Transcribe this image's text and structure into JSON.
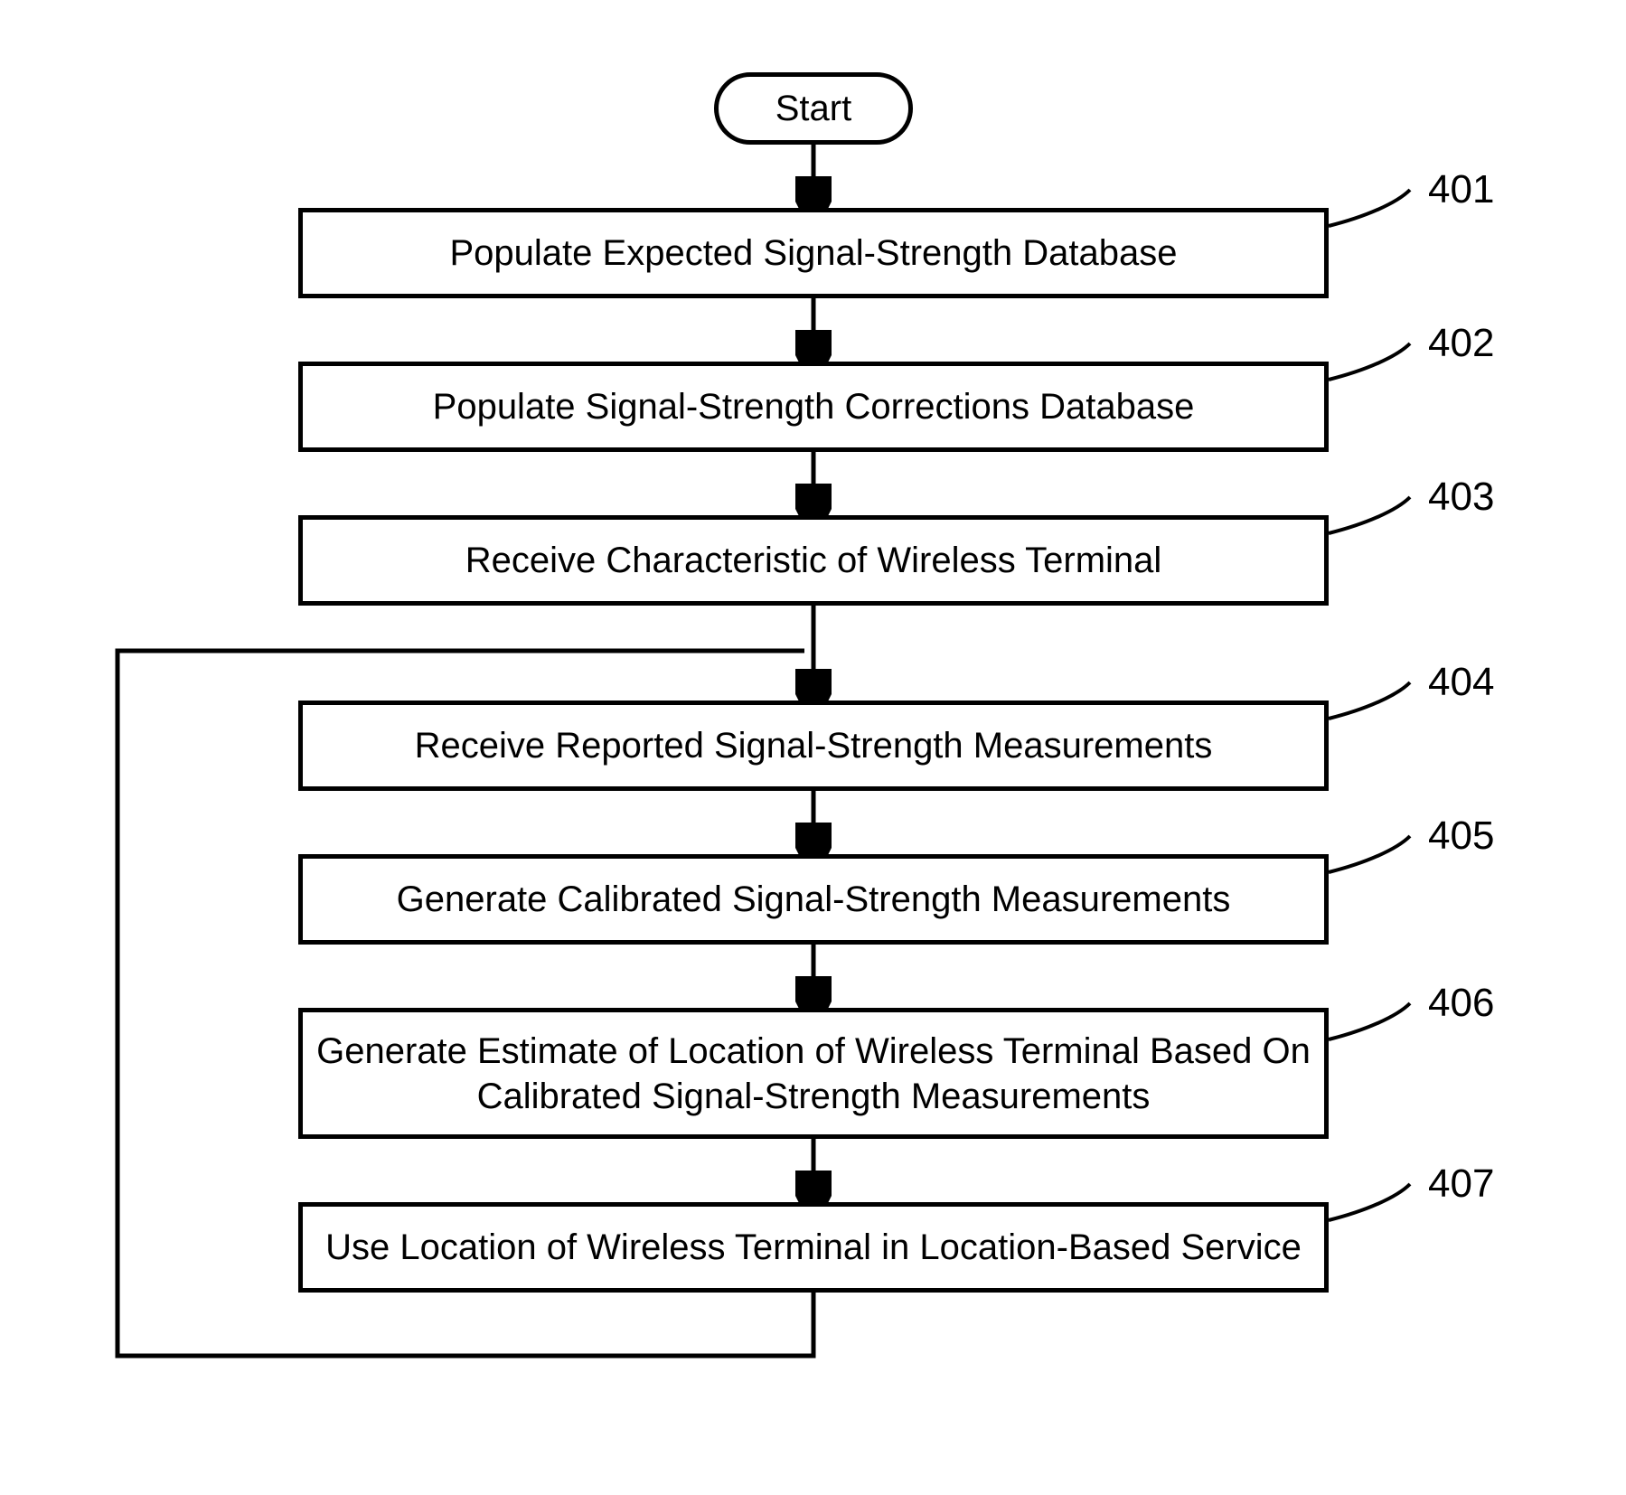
{
  "flow": {
    "start": "Start",
    "steps": [
      {
        "id": "401",
        "text": "Populate Expected Signal-Strength Database"
      },
      {
        "id": "402",
        "text": "Populate Signal-Strength Corrections Database"
      },
      {
        "id": "403",
        "text": "Receive Characteristic of Wireless Terminal"
      },
      {
        "id": "404",
        "text": "Receive Reported Signal-Strength Measurements"
      },
      {
        "id": "405",
        "text": "Generate Calibrated Signal-Strength Measurements"
      },
      {
        "id": "406",
        "text": "Generate Estimate of Location of Wireless Terminal Based On Calibrated Signal-Strength Measurements"
      },
      {
        "id": "407",
        "text": "Use Location of Wireless Terminal in Location-Based Service"
      }
    ],
    "loop_back_from": "407",
    "loop_back_to_before": "404"
  },
  "chart_data": {
    "type": "flowchart",
    "nodes": [
      {
        "id": "start",
        "kind": "terminator",
        "text": "Start"
      },
      {
        "id": "401",
        "kind": "process",
        "text": "Populate Expected Signal-Strength Database"
      },
      {
        "id": "402",
        "kind": "process",
        "text": "Populate Signal-Strength Corrections Database"
      },
      {
        "id": "403",
        "kind": "process",
        "text": "Receive Characteristic of Wireless Terminal"
      },
      {
        "id": "404",
        "kind": "process",
        "text": "Receive Reported Signal-Strength Measurements"
      },
      {
        "id": "405",
        "kind": "process",
        "text": "Generate Calibrated Signal-Strength Measurements"
      },
      {
        "id": "406",
        "kind": "process",
        "text": "Generate Estimate of Location of Wireless Terminal Based On Calibrated Signal-Strength Measurements"
      },
      {
        "id": "407",
        "kind": "process",
        "text": "Use Location of Wireless Terminal in Location-Based Service"
      }
    ],
    "edges": [
      {
        "from": "start",
        "to": "401"
      },
      {
        "from": "401",
        "to": "402"
      },
      {
        "from": "402",
        "to": "403"
      },
      {
        "from": "403",
        "to": "404"
      },
      {
        "from": "404",
        "to": "405"
      },
      {
        "from": "405",
        "to": "406"
      },
      {
        "from": "406",
        "to": "407"
      },
      {
        "from": "407",
        "to": "404",
        "kind": "loop"
      }
    ]
  }
}
